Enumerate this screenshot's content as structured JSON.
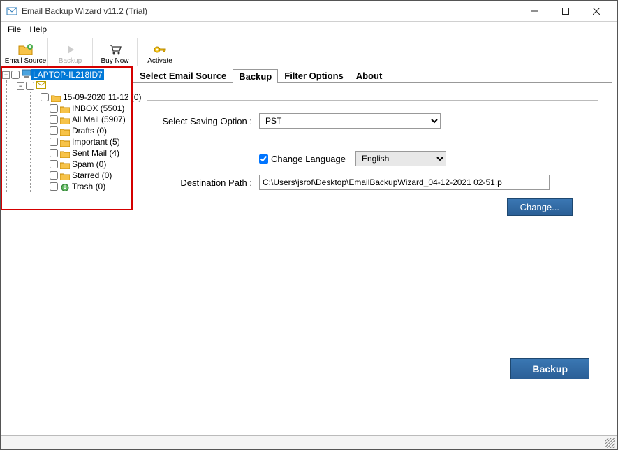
{
  "window": {
    "title": "Email Backup Wizard v11.2 (Trial)"
  },
  "menu": {
    "file": "File",
    "help": "Help"
  },
  "toolbar": {
    "email_source": "Email Source",
    "backup": "Backup",
    "buy_now": "Buy Now",
    "activate": "Activate"
  },
  "tree": {
    "root": "LAPTOP-IL218ID7",
    "items": [
      "15-09-2020 11-12 (0)",
      "INBOX (5501)",
      "All Mail (5907)",
      "Drafts (0)",
      "Important (5)",
      "Sent Mail (4)",
      "Spam (0)",
      "Starred (0)",
      "Trash (0)"
    ]
  },
  "tabs": {
    "select_source": "Select Email Source",
    "backup": "Backup",
    "filter": "Filter Options",
    "about": "About"
  },
  "backup_panel": {
    "saving_label": "Select Saving Option :",
    "saving_value": "PST",
    "change_lang_label": "Change Language",
    "lang_value": "English",
    "dest_label": "Destination Path :",
    "dest_value": "C:\\Users\\jsrof\\Desktop\\EmailBackupWizard_04-12-2021 02-51.p",
    "change_btn": "Change...",
    "backup_btn": "Backup"
  }
}
